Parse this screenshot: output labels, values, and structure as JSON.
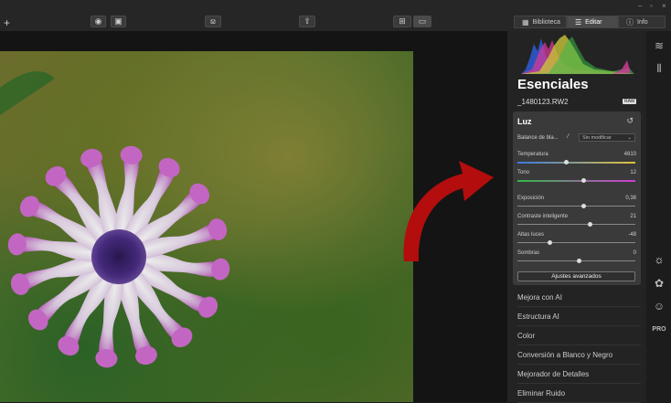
{
  "toolbar": {
    "add_label": "+",
    "eye_glyph": "◉",
    "compare_glyph": "▣",
    "crop_glyph": "⟏",
    "share_glyph": "⇪",
    "grid_glyph": "⊞",
    "single_glyph": "▭",
    "window_controls": [
      "–",
      "▫",
      "×"
    ]
  },
  "tabs": [
    {
      "label": "Biblioteca",
      "icon": "library-icon",
      "glyph": "▦",
      "active": false
    },
    {
      "label": "Editar",
      "icon": "sliders-icon",
      "glyph": "☰",
      "active": true
    },
    {
      "label": "Info",
      "icon": "info-icon",
      "glyph": "ⓘ",
      "active": false
    }
  ],
  "sidebar": {
    "title": "Esenciales",
    "filename": "_1480123.RW2",
    "raw_badge": "RAW"
  },
  "luz": {
    "title": "Luz",
    "reset_glyph": "↺",
    "white_balance_label": "Balance de bla...",
    "white_balance_value": "Sin modificar",
    "sliders": [
      {
        "label": "Temperatura",
        "value": "4810",
        "fraction": 0.41
      },
      {
        "label": "Tono",
        "value": "12",
        "fraction": 0.56
      },
      {
        "label": "Exposición",
        "value": "0,38",
        "fraction": 0.56
      },
      {
        "label": "Contraste inteligente",
        "value": "21",
        "fraction": 0.61
      },
      {
        "label": "Altas luces",
        "value": "-48",
        "fraction": 0.27
      },
      {
        "label": "Sombras",
        "value": "0",
        "fraction": 0.52
      }
    ],
    "advanced_button": "Ajustes avanzados"
  },
  "sections": [
    "Mejora con AI",
    "Estructura AI",
    "Color",
    "Conversión a Blanco y Negro",
    "Mejorador de Detalles",
    "Eliminar Ruido"
  ],
  "iconbar": {
    "layers_glyph": "≋",
    "compare_glyph": "⫴",
    "essentials_glyph": "☼",
    "creative_glyph": "✿",
    "portrait_glyph": "☺",
    "pro_label": "PRO"
  },
  "colors": {
    "accent_arrow": "#b30d0d",
    "temperature_track": "linear-gradient(90deg,#3a78e0,#e0c23a)",
    "tint_track": "linear-gradient(90deg,#2fb84a,#d23ad2)"
  }
}
